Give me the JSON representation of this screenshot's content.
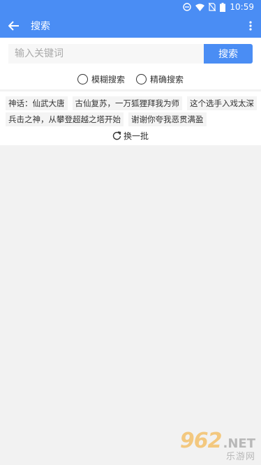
{
  "status_bar": {
    "time": "10:59"
  },
  "app_bar": {
    "title": "搜索"
  },
  "search": {
    "placeholder": "输入关键词",
    "button_label": "搜索"
  },
  "modes": [
    {
      "label": "模糊搜索"
    },
    {
      "label": "精确搜索"
    }
  ],
  "hot_tags": {
    "line1": [
      "神话：仙武大唐",
      "古仙复苏，一万狐狸拜我为师",
      "这个选手入戏太深"
    ],
    "line2": [
      "兵击之神，从攀登超越之塔开始",
      "谢谢你夸我恶贯满盈"
    ]
  },
  "refresh_label": "换一批",
  "watermark": {
    "number": "962",
    "domain": ".NET",
    "sub": "乐游网"
  }
}
